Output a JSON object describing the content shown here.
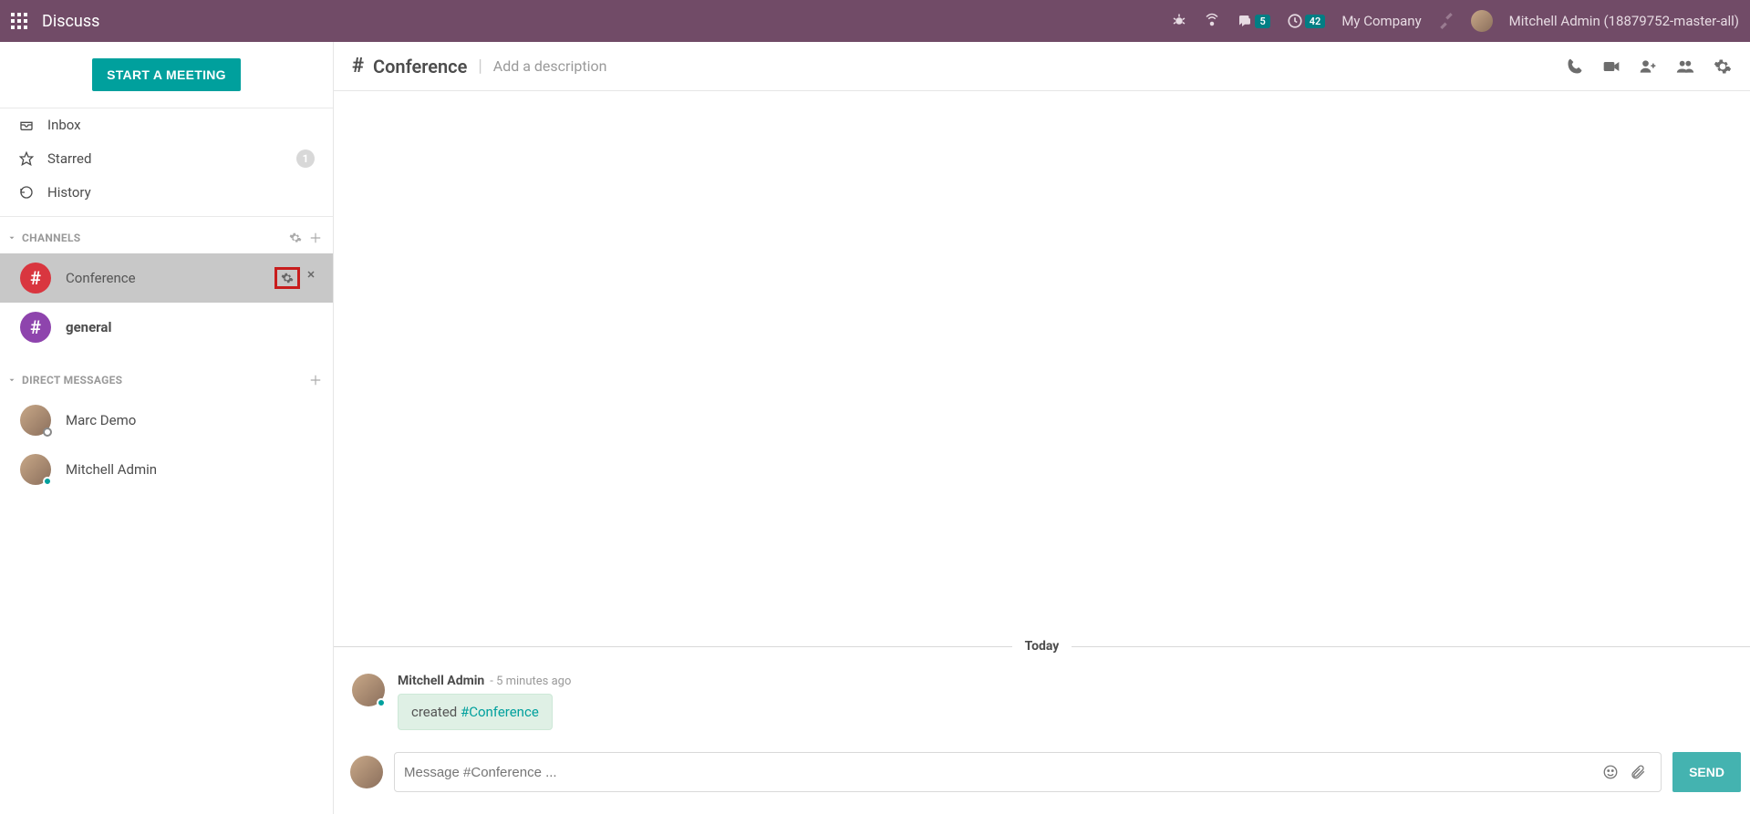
{
  "navbar": {
    "app_title": "Discuss",
    "messages_badge": "5",
    "activities_badge": "42",
    "company": "My Company",
    "user_label": "Mitchell Admin (18879752-master-all)"
  },
  "sidebar": {
    "start_meeting_label": "START A MEETING",
    "mailboxes": [
      {
        "label": "Inbox",
        "icon": "inbox-icon",
        "count": null
      },
      {
        "label": "Starred",
        "icon": "star-icon",
        "count": "1"
      },
      {
        "label": "History",
        "icon": "history-icon",
        "count": null
      }
    ],
    "channels_header": "CHANNELS",
    "channels": [
      {
        "label": "Conference",
        "color": "#d9363f",
        "active": true,
        "bold": false
      },
      {
        "label": "general",
        "color": "#8e44ad",
        "active": false,
        "bold": true
      }
    ],
    "dm_header": "DIRECT MESSAGES",
    "dms": [
      {
        "label": "Marc Demo",
        "status": "offline"
      },
      {
        "label": "Mitchell Admin",
        "status": "online"
      }
    ]
  },
  "chat": {
    "hash": "#",
    "title": "Conference",
    "description_placeholder": "Add a description",
    "date_separator": "Today",
    "message": {
      "author": "Mitchell Admin",
      "time": "- 5 minutes ago",
      "body_prefix": "created ",
      "body_link": "#Conference"
    },
    "composer_placeholder": "Message #Conference ...",
    "send_label": "SEND"
  }
}
